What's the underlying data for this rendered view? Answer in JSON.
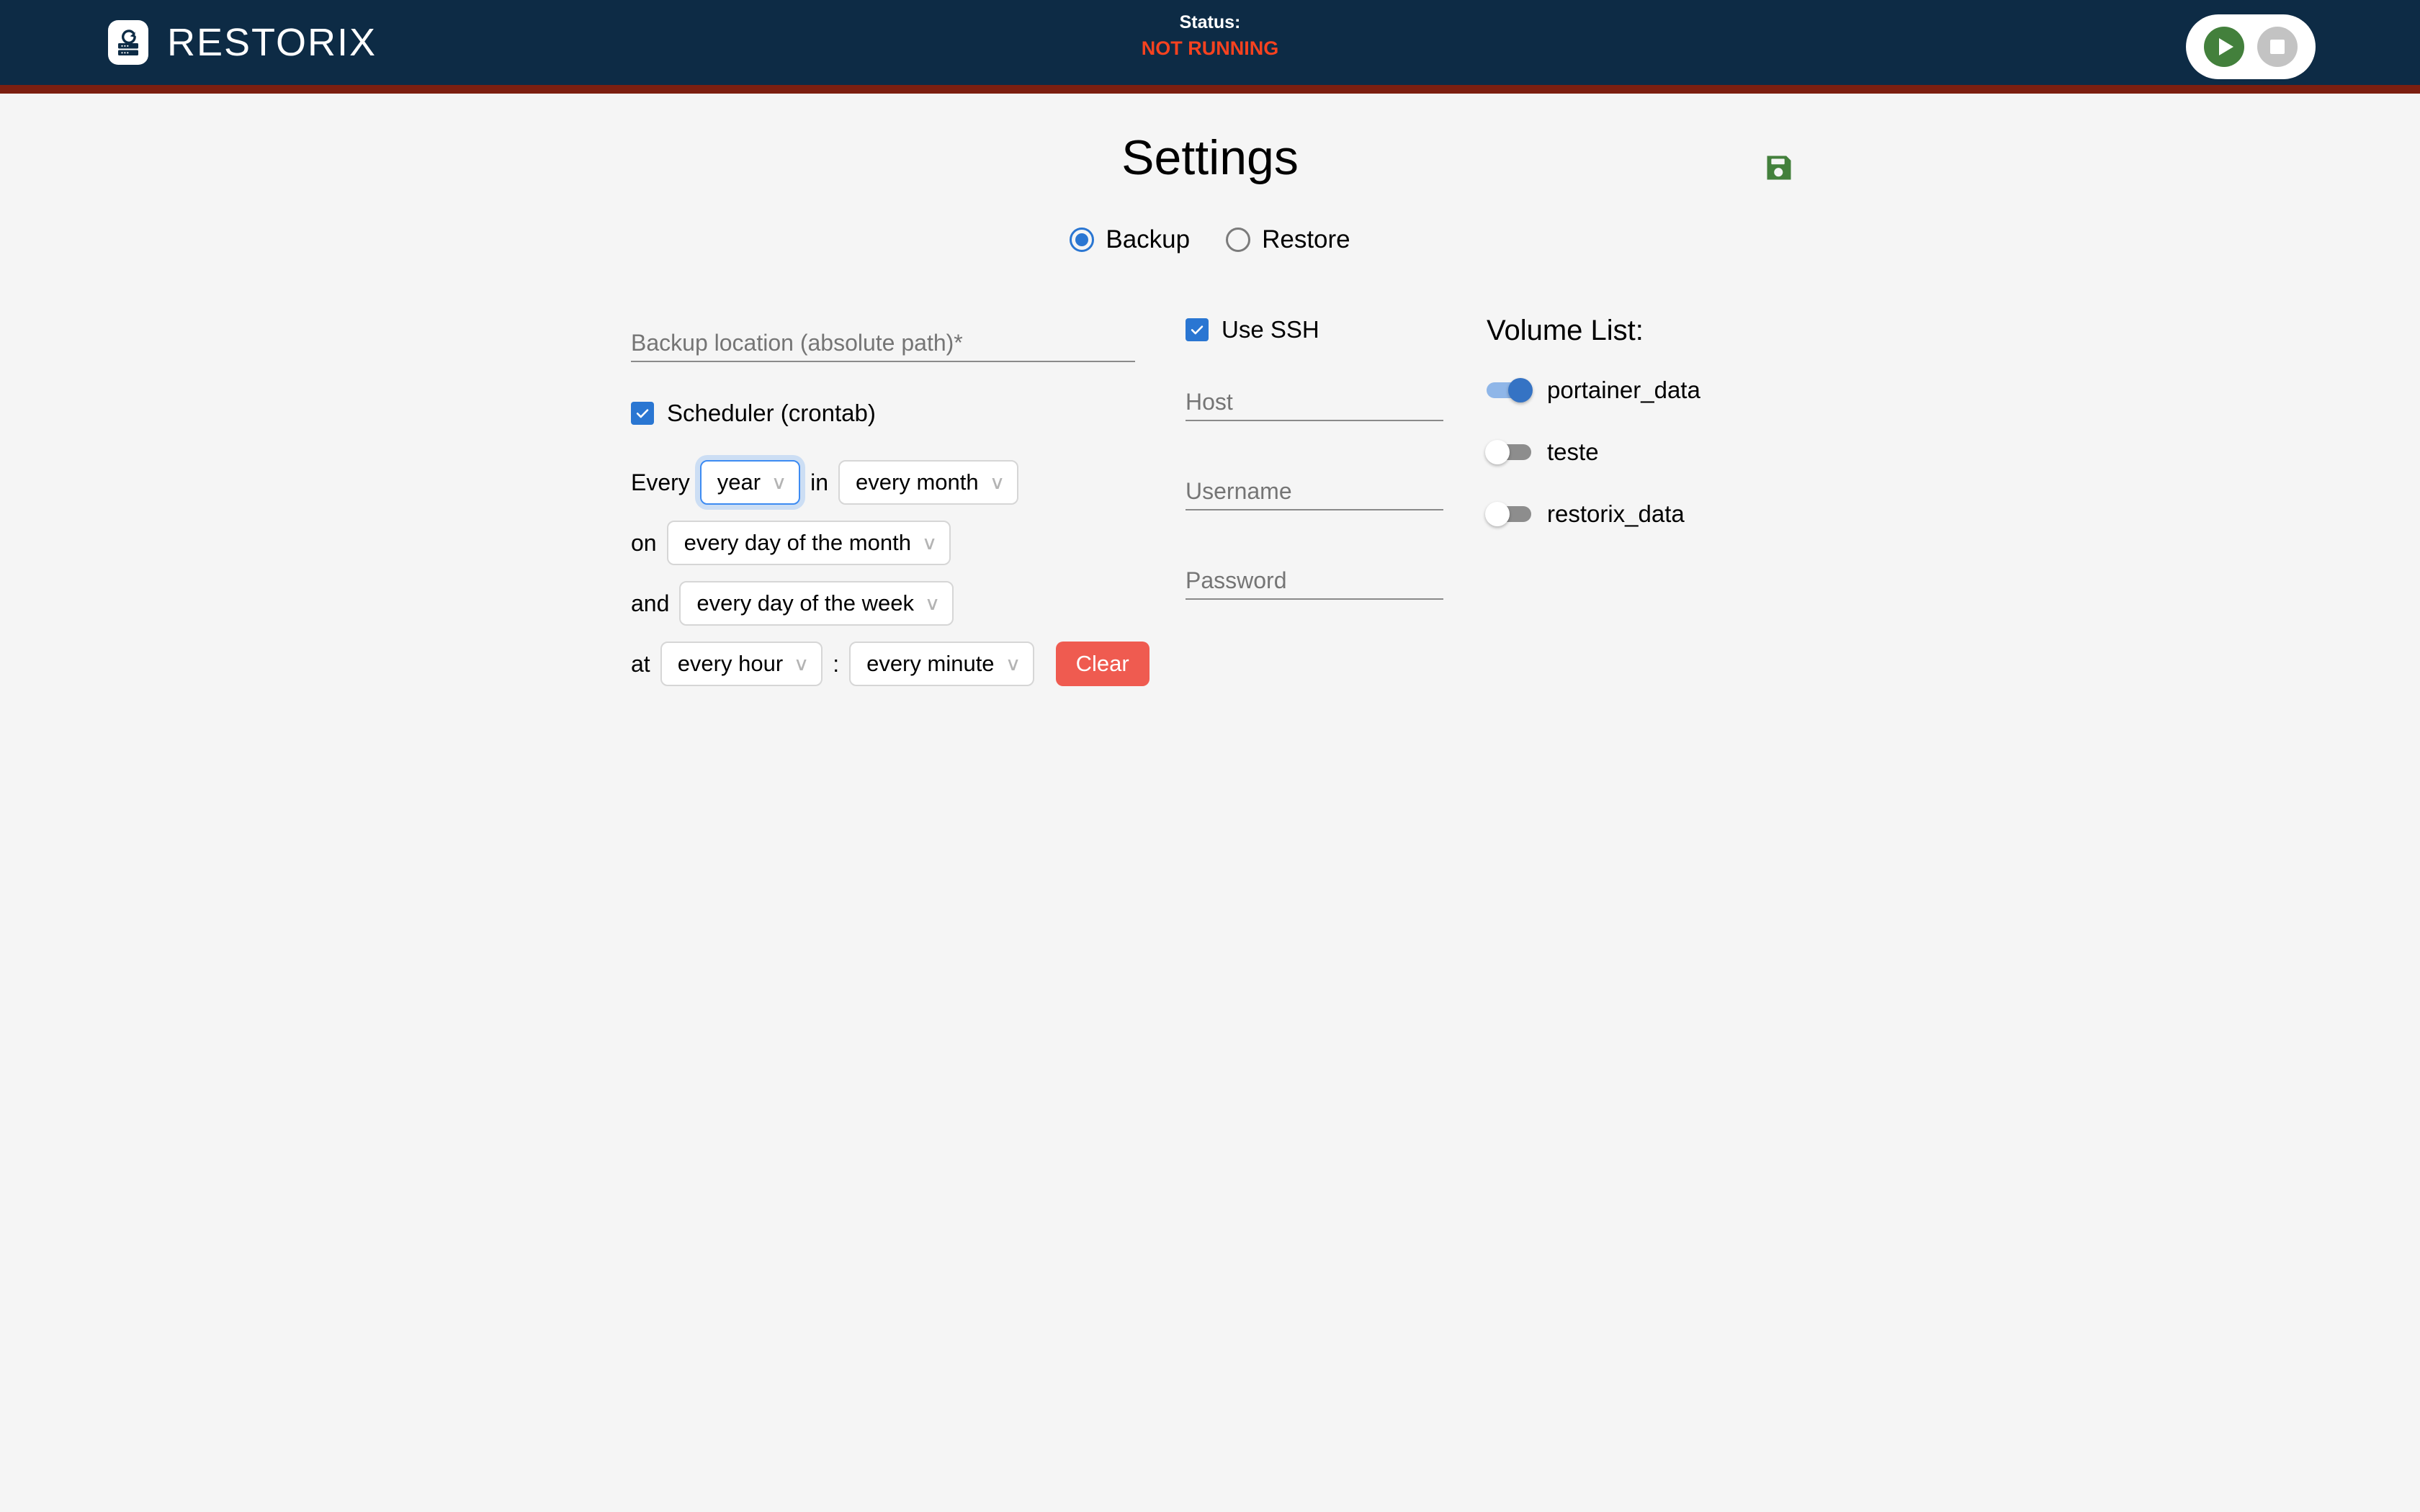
{
  "header": {
    "brand_name": "RESTORIX",
    "logo_icon": "server-restore-icon",
    "status_label": "Status:",
    "status_value": "NOT RUNNING",
    "status_color": "#f6421f",
    "header_bg": "#0d2b45",
    "header_accent": "#7c1f10",
    "controls": {
      "start_icon": "play-icon",
      "stop_icon": "stop-icon",
      "start_color": "#43803c",
      "stop_color": "#c3c3c3"
    }
  },
  "page": {
    "title": "Settings",
    "save_icon": "floppy-save-icon",
    "save_color": "#43803c",
    "background": "#f5f5f5"
  },
  "mode": {
    "selected": "Backup",
    "accent": "#2a76d2",
    "options": [
      {
        "label": "Backup",
        "selected": true
      },
      {
        "label": "Restore",
        "selected": false
      }
    ]
  },
  "backup": {
    "location": {
      "placeholder": "Backup location (absolute path)*",
      "value": ""
    },
    "scheduler": {
      "label": "Scheduler (crontab)",
      "checked": true,
      "checkbox_color": "#2a76d2"
    }
  },
  "cron": {
    "rows": [
      {
        "prefix": "Every",
        "field_value": "year",
        "focused": true,
        "joiner": "in",
        "second_value": "every month",
        "second_focused": false
      },
      {
        "prefix": "on",
        "field_value": "every day of the month",
        "focused": false
      },
      {
        "prefix": "and",
        "field_value": "every day of the week",
        "focused": false
      },
      {
        "prefix": "at",
        "field_value": "every hour",
        "focused": false,
        "joiner": ":",
        "second_value": "every minute",
        "second_focused": false
      }
    ],
    "clear_label": "Clear",
    "clear_color": "#ef5b50",
    "caret_glyph": "∨"
  },
  "ssh": {
    "use_ssh_label": "Use SSH",
    "use_ssh_checked": true,
    "fields": [
      {
        "placeholder": "Host",
        "value": "",
        "type": "text"
      },
      {
        "placeholder": "Username",
        "value": "",
        "type": "text"
      },
      {
        "placeholder": "Password",
        "value": "",
        "type": "password"
      }
    ]
  },
  "volumes": {
    "title": "Volume List:",
    "on_color": "#3573c4",
    "off_color": "#8d8d8d",
    "items": [
      {
        "name": "portainer_data",
        "enabled": true
      },
      {
        "name": "teste",
        "enabled": false
      },
      {
        "name": "restorix_data",
        "enabled": false
      }
    ]
  }
}
